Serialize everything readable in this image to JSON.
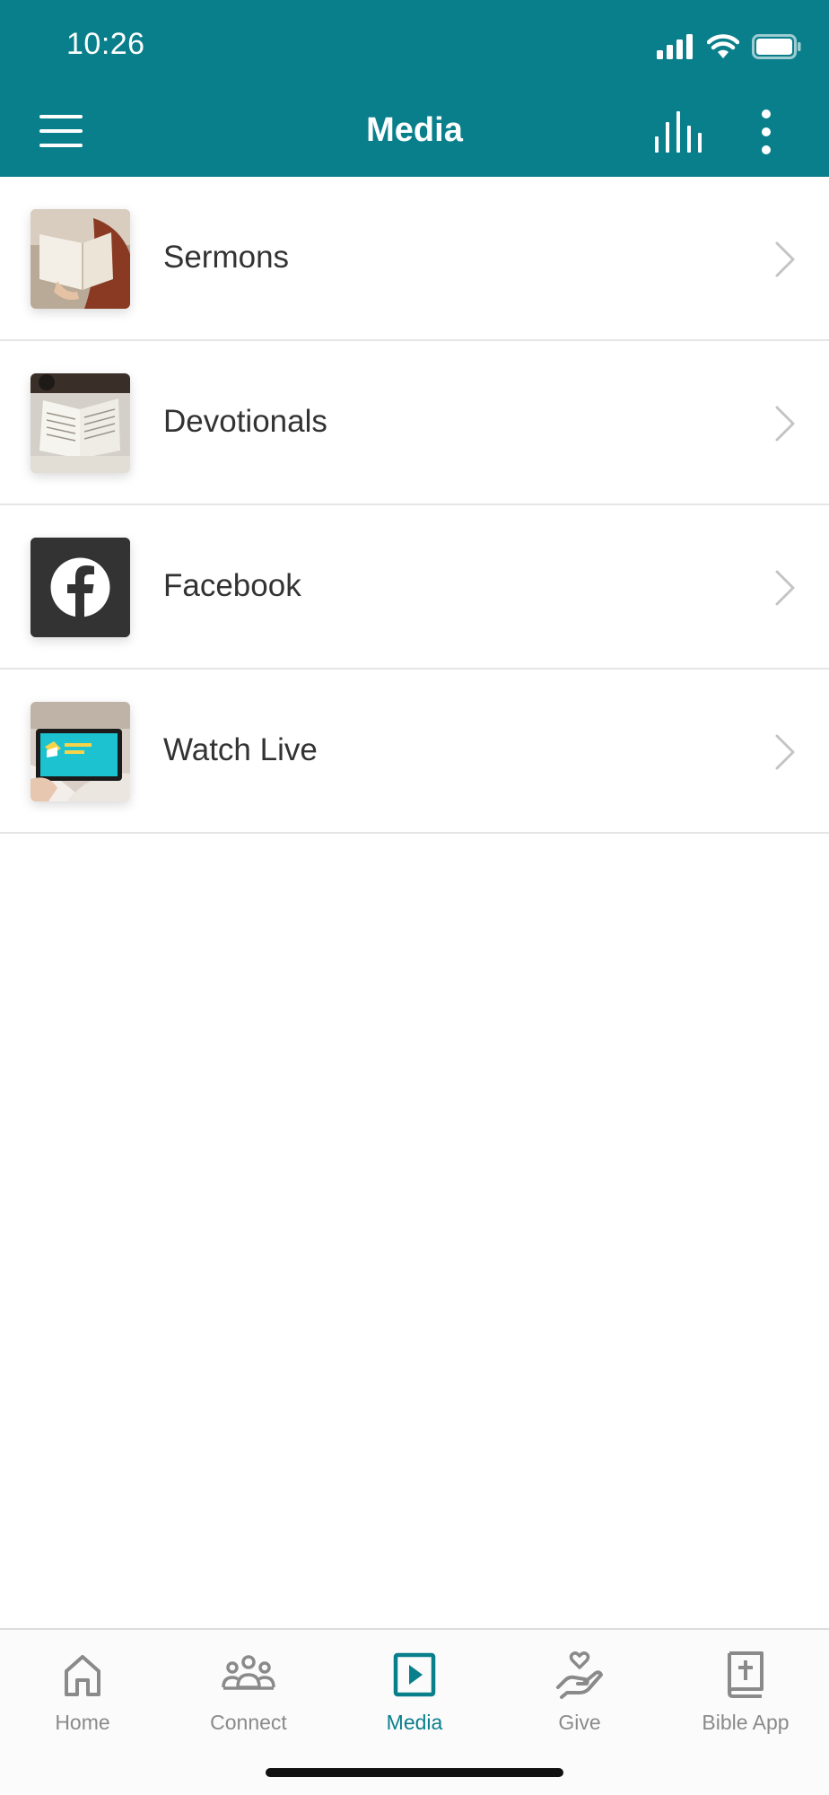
{
  "status_bar": {
    "time": "10:26"
  },
  "header": {
    "title": "Media",
    "background_color": "#0a7f8c",
    "icons": [
      "menu-icon",
      "audio-bars-icon",
      "more-vertical-icon"
    ]
  },
  "media_list": [
    {
      "label": "Sermons",
      "thumbnail": "sermons-thumbnail"
    },
    {
      "label": "Devotionals",
      "thumbnail": "devotionals-thumbnail"
    },
    {
      "label": "Facebook",
      "thumbnail": "facebook-icon"
    },
    {
      "label": "Watch Live",
      "thumbnail": "watch-live-thumbnail"
    }
  ],
  "bottom_nav": {
    "active": "Media",
    "accent_color": "#0a7f8c",
    "items": [
      {
        "label": "Home",
        "icon": "home-icon"
      },
      {
        "label": "Connect",
        "icon": "people-icon"
      },
      {
        "label": "Media",
        "icon": "play-icon"
      },
      {
        "label": "Give",
        "icon": "give-hand-icon"
      },
      {
        "label": "Bible App",
        "icon": "bible-icon"
      }
    ]
  }
}
